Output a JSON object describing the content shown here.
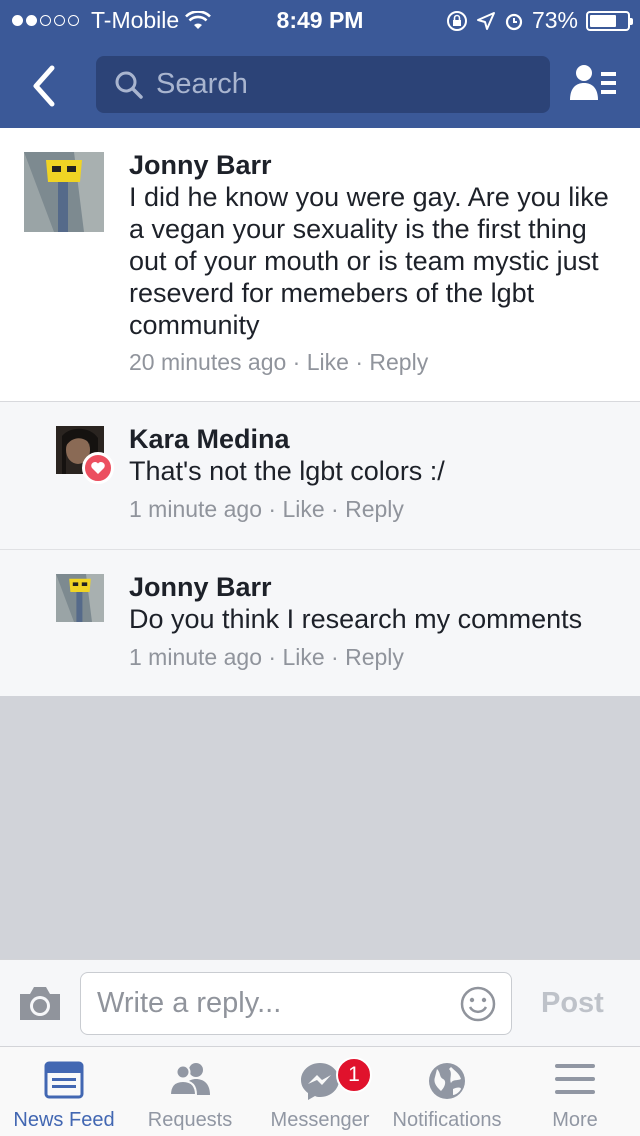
{
  "status_bar": {
    "carrier": "T-Mobile",
    "time": "8:49 PM",
    "battery": "73%",
    "battery_level": 0.73
  },
  "nav": {
    "search_placeholder": "Search"
  },
  "comments": [
    {
      "name": "Jonny Barr",
      "text": "I did he know you were gay. Are you like a vegan your sexuality is the first thing out of your mouth or is team mystic just reseverd for memebers of the lgbt community",
      "time": "20 minutes ago",
      "like": "Like",
      "reply": "Reply"
    },
    {
      "name": "Kara Medina",
      "text": "That's not the lgbt colors :/",
      "time": "1 minute ago",
      "like": "Like",
      "reply": "Reply"
    },
    {
      "name": "Jonny Barr",
      "text": "Do you think I research my comments",
      "time": "1 minute ago",
      "like": "Like",
      "reply": "Reply"
    }
  ],
  "reply_bar": {
    "placeholder": "Write a reply...",
    "post_label": "Post"
  },
  "tabs": [
    {
      "label": "News Feed",
      "icon": "news-feed-icon",
      "active": true
    },
    {
      "label": "Requests",
      "icon": "friend-requests-icon"
    },
    {
      "label": "Messenger",
      "icon": "messenger-icon",
      "badge": "1"
    },
    {
      "label": "Notifications",
      "icon": "globe-icon"
    },
    {
      "label": "More",
      "icon": "menu-icon"
    }
  ],
  "colors": {
    "brand": "#3b5998",
    "active_tab": "#4267b2",
    "badge": "#e0122c",
    "heart": "#ec4f5f"
  }
}
